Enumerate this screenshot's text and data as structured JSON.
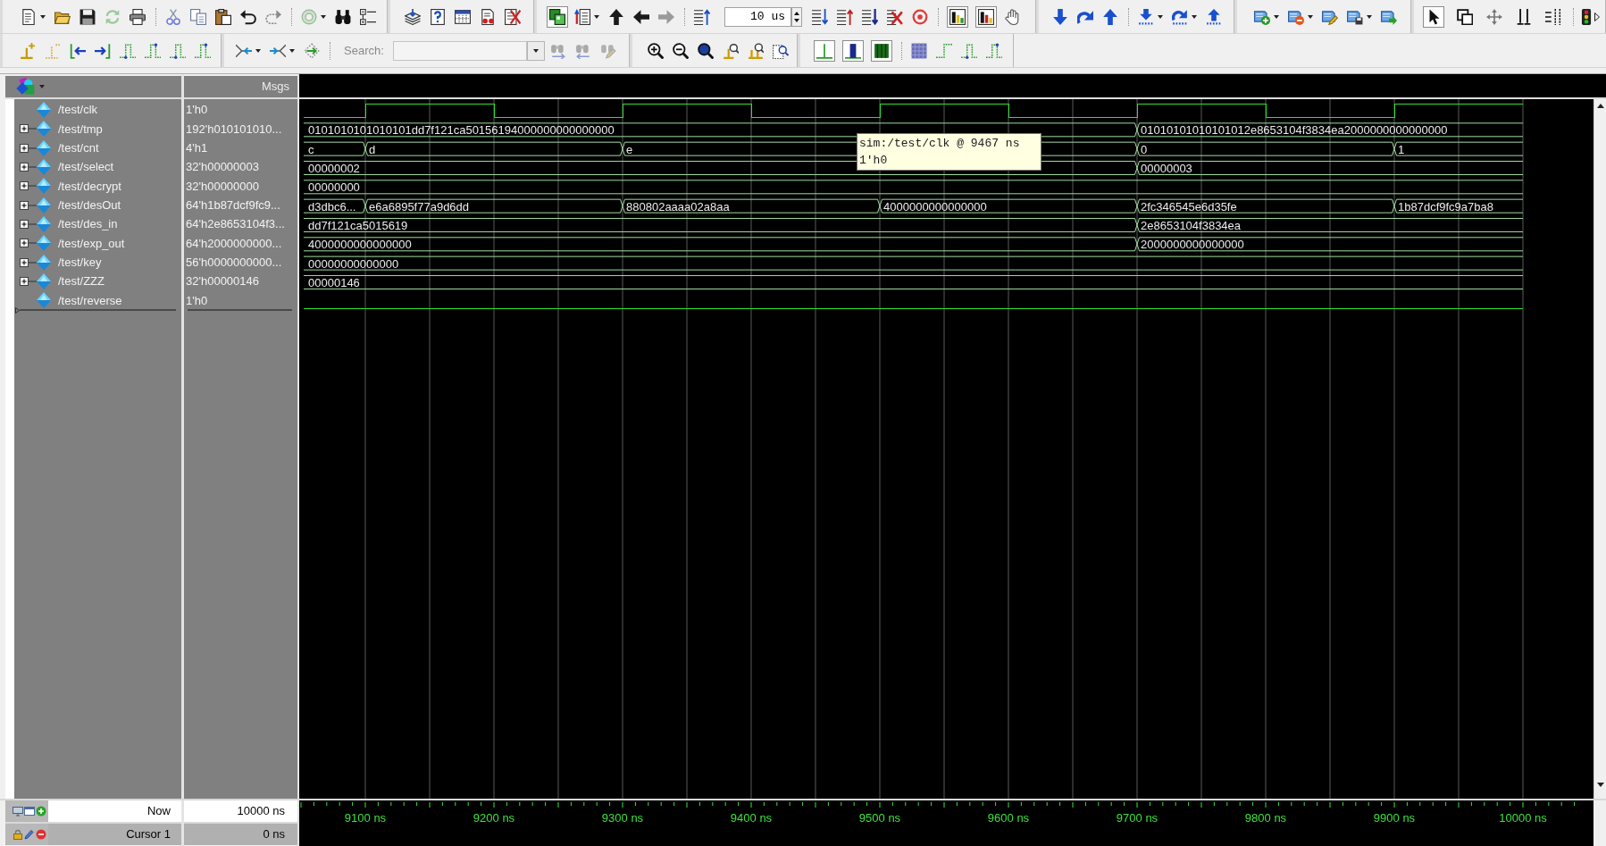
{
  "toolbar": {
    "time_field": {
      "value": "10 us"
    },
    "search": {
      "label": "Search:"
    }
  },
  "wave": {
    "values_heading": "Msgs",
    "signals": [
      {
        "name": "/test/clk",
        "value": "1'h0",
        "kind": "bit",
        "expandable": false,
        "half_cycles": [
          {
            "high": false
          },
          {
            "high": true
          },
          {
            "high": false
          },
          {
            "high": true
          },
          {
            "high": false
          },
          {
            "high": true
          },
          {
            "high": false
          },
          {
            "high": true
          },
          {
            "high": false
          },
          {
            "high": true
          }
        ]
      },
      {
        "name": "/test/tmp",
        "value": "192'h010101010...",
        "kind": "bus",
        "expandable": true,
        "cycles": [
          {
            "value": "0101010101010101dd7f121ca50156194000000000000000"
          },
          {
            "transition": false
          },
          {
            "transition": false
          },
          {
            "transition": false
          },
          {
            "transition": true,
            "value": "01010101010101012e8653104f3834ea2000000000000000"
          },
          {
            "transition": false
          }
        ]
      },
      {
        "name": "/test/cnt",
        "value": "4'h1",
        "kind": "bus",
        "expandable": true,
        "cycles": [
          {
            "value": "c"
          },
          {
            "transition": true,
            "value": "d"
          },
          {
            "transition": true,
            "value": "e"
          },
          {
            "transition": false
          },
          {
            "transition": true,
            "value": "0"
          },
          {
            "transition": true,
            "value": "1"
          }
        ]
      },
      {
        "name": "/test/select",
        "value": "32'h00000003",
        "kind": "bus",
        "expandable": true,
        "cycles": [
          {
            "value": "00000002"
          },
          {
            "transition": false
          },
          {
            "transition": false
          },
          {
            "transition": false
          },
          {
            "transition": true,
            "value": "00000003"
          },
          {
            "transition": false
          }
        ]
      },
      {
        "name": "/test/decrypt",
        "value": "32'h00000000",
        "kind": "bus",
        "expandable": true,
        "cycles": [
          {
            "value": "00000000"
          },
          {
            "transition": false
          },
          {
            "transition": false
          },
          {
            "transition": false
          },
          {
            "transition": false
          },
          {
            "transition": false
          }
        ]
      },
      {
        "name": "/test/desOut",
        "value": "64'h1b87dcf9fc9...",
        "kind": "bus",
        "expandable": true,
        "cycles": [
          {
            "value": "d3dbc6..."
          },
          {
            "transition": true,
            "value": "e6a6895f77a9d6dd"
          },
          {
            "transition": true,
            "value": "880802aaaa02a8aa"
          },
          {
            "transition": true,
            "value": "4000000000000000"
          },
          {
            "transition": true,
            "value": "2fc346545e6d35fe"
          },
          {
            "transition": true,
            "value": "1b87dcf9fc9a7ba8"
          }
        ]
      },
      {
        "name": "/test/des_in",
        "value": "64'h2e8653104f3...",
        "kind": "bus",
        "expandable": true,
        "cycles": [
          {
            "value": "dd7f121ca5015619"
          },
          {
            "transition": false
          },
          {
            "transition": false
          },
          {
            "transition": false
          },
          {
            "transition": true,
            "value": "2e8653104f3834ea"
          },
          {
            "transition": false
          }
        ]
      },
      {
        "name": "/test/exp_out",
        "value": "64'h2000000000...",
        "kind": "bus",
        "expandable": true,
        "cycles": [
          {
            "value": "4000000000000000"
          },
          {
            "transition": false
          },
          {
            "transition": false
          },
          {
            "transition": false
          },
          {
            "transition": true,
            "value": "2000000000000000"
          },
          {
            "transition": false
          }
        ]
      },
      {
        "name": "/test/key",
        "value": "56'h0000000000...",
        "kind": "bus",
        "expandable": true,
        "cycles": [
          {
            "value": "00000000000000"
          },
          {
            "transition": false
          },
          {
            "transition": false
          },
          {
            "transition": false
          },
          {
            "transition": false
          },
          {
            "transition": false
          }
        ]
      },
      {
        "name": "/test/ZZZ",
        "value": "32'h00000146",
        "kind": "bus",
        "expandable": true,
        "cycles": [
          {
            "value": "00000146"
          },
          {
            "transition": false
          },
          {
            "transition": false
          },
          {
            "transition": false
          },
          {
            "transition": false
          },
          {
            "transition": false
          }
        ]
      },
      {
        "name": "/test/reverse",
        "value": "1'h0",
        "kind": "bit",
        "expandable": false,
        "half_cycles": [
          {
            "high": false
          },
          {
            "high": false
          },
          {
            "high": false
          },
          {
            "high": false
          },
          {
            "high": false
          },
          {
            "high": false
          },
          {
            "high": false
          },
          {
            "high": false
          },
          {
            "high": false
          },
          {
            "high": false
          }
        ]
      }
    ],
    "tooltip": {
      "lines": [
        "sim:/test/clk @ 9467 ns",
        "1'h0"
      ]
    },
    "now": {
      "label": "Now",
      "value": "10000 ns"
    },
    "cursor": {
      "label": "Cursor 1",
      "value": "0 ns"
    },
    "time_labels": [
      "9100 ns",
      "9200 ns",
      "9300 ns",
      "9400 ns",
      "9500 ns",
      "9600 ns",
      "9700 ns",
      "9800 ns",
      "9900 ns",
      "10000 ns"
    ]
  }
}
